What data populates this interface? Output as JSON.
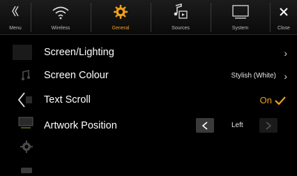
{
  "tabs": [
    {
      "label": "Menu",
      "icon": "menu-icon"
    },
    {
      "label": "Wireless",
      "icon": "wireless-icon"
    },
    {
      "label": "General",
      "icon": "gear-icon",
      "active": true
    },
    {
      "label": "Sources",
      "icon": "music-source-icon"
    },
    {
      "label": "System",
      "icon": "monitor-icon"
    },
    {
      "label": "Close",
      "icon": "close-icon"
    }
  ],
  "rows": {
    "screen_lighting": {
      "title": "Screen/Lighting"
    },
    "screen_colour": {
      "title": "Screen Colour",
      "value": "Stylish (White)"
    },
    "text_scroll": {
      "title": "Text Scroll",
      "value": "On"
    },
    "artwork_position": {
      "title": "Artwork Position",
      "value": "Left"
    }
  },
  "colors": {
    "accent": "#f0a01c",
    "background": "#000000"
  }
}
